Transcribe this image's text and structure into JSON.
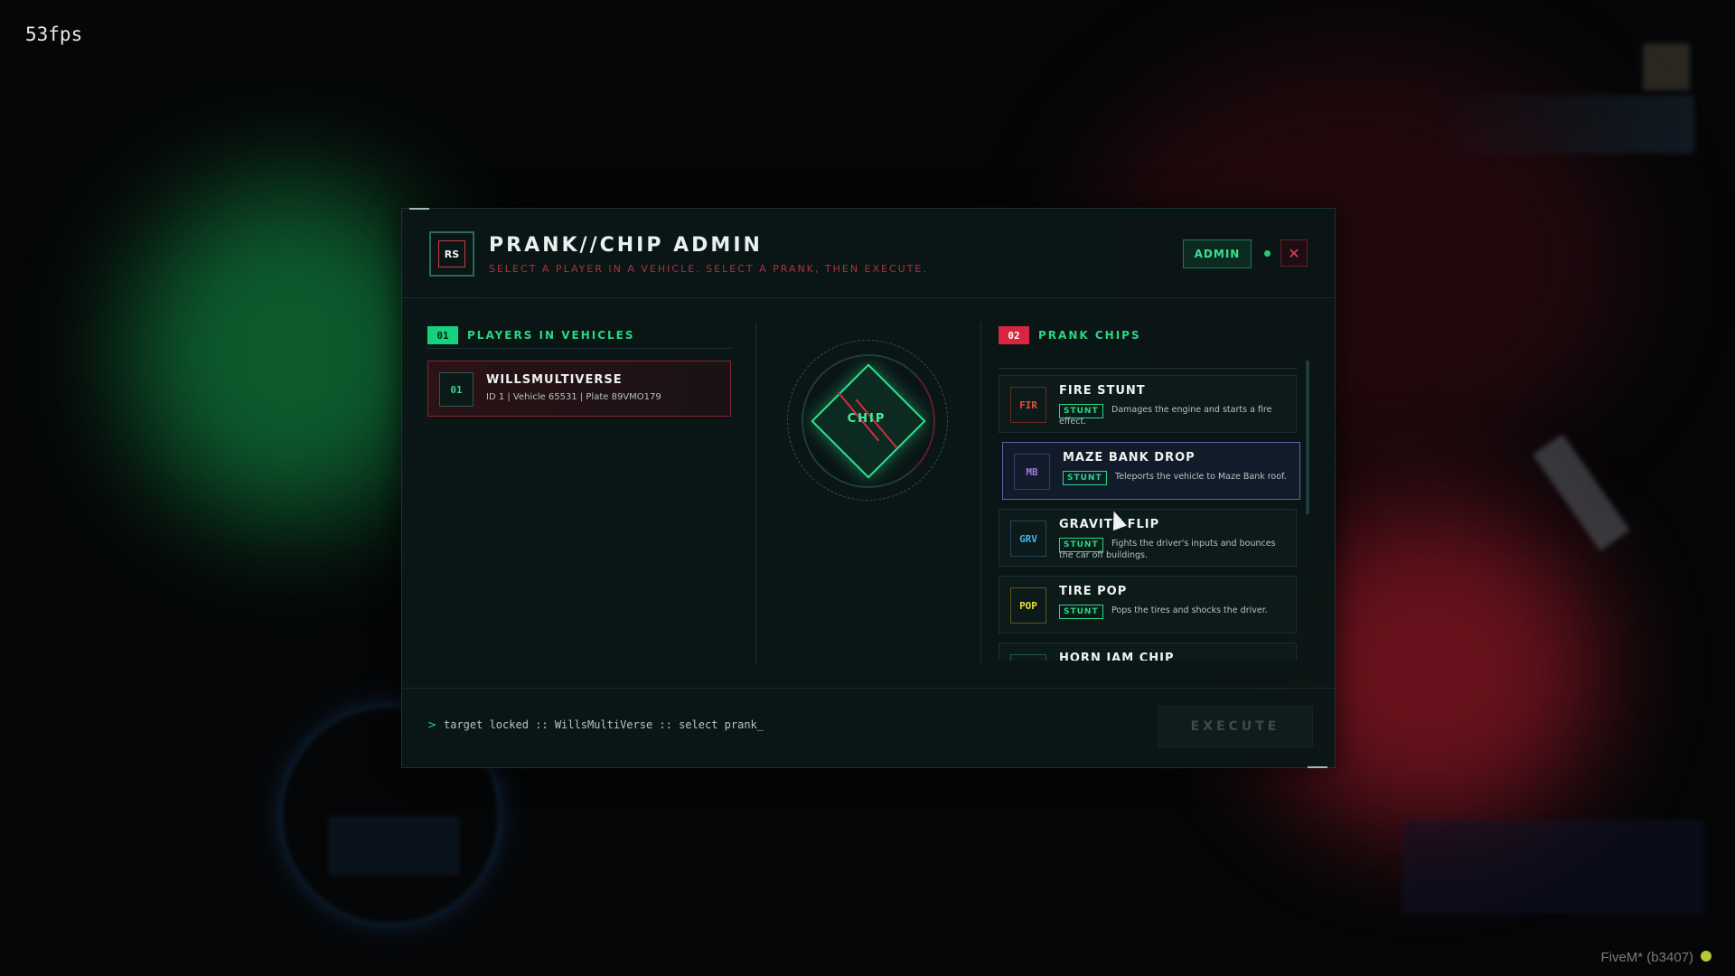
{
  "overlay": {
    "fps": "53fps",
    "fivem_label": "FiveM* (b3407)"
  },
  "panel": {
    "logo_text": "RS",
    "title": "PRANK//CHIP ADMIN",
    "subtitle": "SELECT A PLAYER IN A VEHICLE. SELECT A PRANK, THEN EXECUTE.",
    "admin_label": "ADMIN",
    "close_label": "✕"
  },
  "players": {
    "section_number": "01",
    "section_title": "PLAYERS IN VEHICLES",
    "items": [
      {
        "num": "01",
        "name": "WILLSMULTIVERSE",
        "meta": "ID 1 | Vehicle 65531 | Plate 89VMO179"
      }
    ]
  },
  "center_chip": {
    "label": "CHIP"
  },
  "pranks": {
    "section_number": "02",
    "section_title": "PRANK CHIPS",
    "items": [
      {
        "code": "FIR",
        "code_color": "#e0533a",
        "name": "FIRE STUNT",
        "tag": "STUNT",
        "desc": "Damages the engine and starts a fire effect."
      },
      {
        "code": "MB",
        "code_color": "#9b7be0",
        "name": "MAZE BANK DROP",
        "tag": "STUNT",
        "desc": "Teleports the vehicle to Maze Bank roof."
      },
      {
        "code": "GRV",
        "code_color": "#39b8e8",
        "name": "GRAVITY FLIP",
        "tag": "STUNT",
        "desc": "Fights the driver's inputs and bounces the car off buildings."
      },
      {
        "code": "POP",
        "code_color": "#e8e03a",
        "name": "TIRE POP",
        "tag": "STUNT",
        "desc": "Pops the tires and shocks the driver."
      },
      {
        "code": "",
        "code_color": "#28d784",
        "name": "HORN JAM CHIP",
        "tag": "",
        "desc": ""
      }
    ]
  },
  "footer": {
    "prompt": ">",
    "console": "target locked :: WillsMultiVerse :: select prank_",
    "execute_label": "EXECUTE"
  },
  "colors": {
    "accent_green": "#28d784",
    "accent_red": "#d7263d"
  }
}
